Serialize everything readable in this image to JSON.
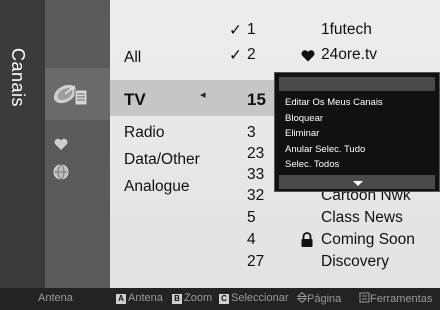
{
  "side_tab": {
    "label": "Canais"
  },
  "categories": [
    {
      "label": "All"
    },
    {
      "label": "TV"
    },
    {
      "label": "Radio"
    },
    {
      "label": "Data/Other"
    },
    {
      "label": "Analogue"
    }
  ],
  "left_arrow": "◂",
  "channels": [
    {
      "check": "✓",
      "number": "1",
      "name": "1futech"
    },
    {
      "check": "✓",
      "number": "2",
      "name": "24ore.tv"
    },
    {
      "number": "15"
    },
    {
      "number": "3"
    },
    {
      "number": "23"
    },
    {
      "number": "33"
    },
    {
      "number": "32",
      "name": "Cartoon Nwk"
    },
    {
      "number": "5",
      "name": "Class News"
    },
    {
      "number": "4",
      "name": "Coming Soon"
    },
    {
      "number": "27",
      "name": "Discovery"
    }
  ],
  "favorite_icon": "heart-icon",
  "lock_icon": "lock-icon",
  "popup_menu": {
    "items": [
      "Editar Os Meus Canais",
      "Bloquear",
      "Eliminar",
      "Anular Selec. Tudo",
      "Selec. Todos"
    ]
  },
  "footer": {
    "antena_label": "Antena",
    "a_key": "A",
    "a_label": "Antena",
    "b_key": "B",
    "b_label": "Zoom",
    "c_key": "C",
    "c_label": "Seleccionar",
    "page_label": "Página",
    "tools_label": "Ferramentas"
  }
}
